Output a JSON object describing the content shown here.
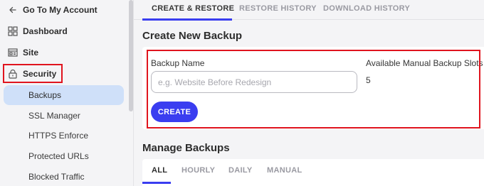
{
  "sidebar": {
    "back_label": "Go To My Account",
    "items": [
      {
        "label": "Dashboard",
        "icon": "grid-icon"
      },
      {
        "label": "Site",
        "icon": "site-icon"
      },
      {
        "label": "Security",
        "icon": "lock-icon"
      }
    ],
    "security_items": [
      {
        "label": "Backups",
        "active": true
      },
      {
        "label": "SSL Manager"
      },
      {
        "label": "HTTPS Enforce"
      },
      {
        "label": "Protected URLs"
      },
      {
        "label": "Blocked Traffic"
      }
    ]
  },
  "tabs": [
    "CREATE & RESTORE",
    "RESTORE HISTORY",
    "DOWNLOAD HISTORY"
  ],
  "create": {
    "heading": "Create New Backup",
    "name_label": "Backup Name",
    "name_placeholder": "e.g. Website Before Redesign",
    "slots_label": "Available Manual Backup Slots",
    "slots_value": "5",
    "create_button": "CREATE"
  },
  "manage": {
    "heading": "Manage Backups",
    "tabs": [
      "ALL",
      "HOURLY",
      "DAILY",
      "MANUAL"
    ]
  },
  "colors": {
    "accent": "#3a3df0",
    "highlight": "#e0141e",
    "active_bg": "#cfe0f9"
  }
}
